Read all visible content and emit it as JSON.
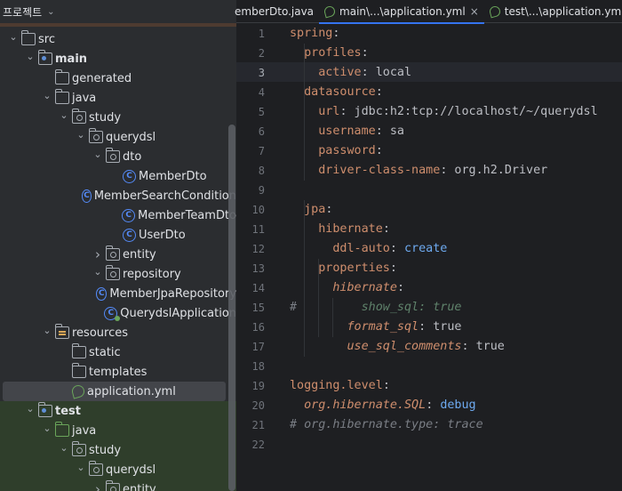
{
  "project": {
    "title": "프로젝트",
    "tree": [
      {
        "label": "src",
        "depth": 1,
        "arrow": "down",
        "icon": "folder"
      },
      {
        "label": "main",
        "depth": 2,
        "arrow": "down",
        "icon": "source-root-folder",
        "bold": true
      },
      {
        "label": "generated",
        "depth": 3,
        "arrow": "none",
        "icon": "folder"
      },
      {
        "label": "java",
        "depth": 3,
        "arrow": "down",
        "icon": "source-folder"
      },
      {
        "label": "study",
        "depth": 4,
        "arrow": "down",
        "icon": "package"
      },
      {
        "label": "querydsl",
        "depth": 5,
        "arrow": "down",
        "icon": "package"
      },
      {
        "label": "dto",
        "depth": 6,
        "arrow": "down",
        "icon": "package"
      },
      {
        "label": "MemberDto",
        "depth": 7,
        "arrow": "none",
        "icon": "class"
      },
      {
        "label": "MemberSearchCondition",
        "depth": 7,
        "arrow": "none",
        "icon": "class"
      },
      {
        "label": "MemberTeamDto",
        "depth": 7,
        "arrow": "none",
        "icon": "class"
      },
      {
        "label": "UserDto",
        "depth": 7,
        "arrow": "none",
        "icon": "class"
      },
      {
        "label": "entity",
        "depth": 6,
        "arrow": "right",
        "icon": "package"
      },
      {
        "label": "repository",
        "depth": 6,
        "arrow": "down",
        "icon": "package"
      },
      {
        "label": "MemberJpaRepository",
        "depth": 7,
        "arrow": "none",
        "icon": "class"
      },
      {
        "label": "QuerydslApplication",
        "depth": 6,
        "arrow": "none",
        "icon": "spring-class"
      },
      {
        "label": "resources",
        "depth": 3,
        "arrow": "down",
        "icon": "resources-folder"
      },
      {
        "label": "static",
        "depth": 4,
        "arrow": "none",
        "icon": "folder"
      },
      {
        "label": "templates",
        "depth": 4,
        "arrow": "none",
        "icon": "folder"
      },
      {
        "label": "application.yml",
        "depth": 4,
        "arrow": "none",
        "icon": "yaml-file",
        "selected": true
      },
      {
        "label": "test",
        "depth": 2,
        "arrow": "down",
        "icon": "test-root-folder",
        "bold": true
      },
      {
        "label": "java",
        "depth": 3,
        "arrow": "down",
        "icon": "test-source-folder"
      },
      {
        "label": "study",
        "depth": 4,
        "arrow": "down",
        "icon": "package"
      },
      {
        "label": "querydsl",
        "depth": 5,
        "arrow": "down",
        "icon": "package"
      },
      {
        "label": "entity",
        "depth": 6,
        "arrow": "right",
        "icon": "package"
      }
    ]
  },
  "tabs": [
    {
      "label": "MemberDto.java",
      "active": false,
      "icon": "java-class-icon"
    },
    {
      "label": "main\\...\\application.yml",
      "active": true,
      "icon": "yaml-icon",
      "close": "×"
    },
    {
      "label": "test\\...\\application.yml",
      "active": false,
      "icon": "yaml-icon"
    }
  ],
  "editor": {
    "current_line": 3,
    "lines": [
      {
        "n": "1",
        "segs": [
          {
            "t": "spring",
            "c": "k"
          },
          {
            "t": ":",
            "c": "v"
          }
        ]
      },
      {
        "n": "2",
        "segs": [
          {
            "t": "  ",
            "c": "v"
          },
          {
            "t": "profiles",
            "c": "k"
          },
          {
            "t": ":",
            "c": "v"
          }
        ]
      },
      {
        "n": "3",
        "segs": [
          {
            "t": "    ",
            "c": "v"
          },
          {
            "t": "active",
            "c": "k"
          },
          {
            "t": ": local",
            "c": "v"
          }
        ]
      },
      {
        "n": "4",
        "segs": [
          {
            "t": "  ",
            "c": "v"
          },
          {
            "t": "datasource",
            "c": "k"
          },
          {
            "t": ":",
            "c": "v"
          }
        ]
      },
      {
        "n": "5",
        "segs": [
          {
            "t": "    ",
            "c": "v"
          },
          {
            "t": "url",
            "c": "k"
          },
          {
            "t": ": jdbc:h2:tcp://localhost/~/querydsl",
            "c": "v"
          }
        ]
      },
      {
        "n": "6",
        "segs": [
          {
            "t": "    ",
            "c": "v"
          },
          {
            "t": "username",
            "c": "k"
          },
          {
            "t": ": sa",
            "c": "v"
          }
        ]
      },
      {
        "n": "7",
        "segs": [
          {
            "t": "    ",
            "c": "v"
          },
          {
            "t": "password",
            "c": "k"
          },
          {
            "t": ":",
            "c": "v"
          }
        ]
      },
      {
        "n": "8",
        "segs": [
          {
            "t": "    ",
            "c": "v"
          },
          {
            "t": "driver-class-name",
            "c": "k"
          },
          {
            "t": ": org.h2.Driver",
            "c": "v"
          }
        ]
      },
      {
        "n": "9",
        "segs": []
      },
      {
        "n": "10",
        "segs": [
          {
            "t": "  ",
            "c": "v"
          },
          {
            "t": "jpa",
            "c": "k"
          },
          {
            "t": ":",
            "c": "v"
          }
        ]
      },
      {
        "n": "11",
        "segs": [
          {
            "t": "    ",
            "c": "v"
          },
          {
            "t": "hibernate",
            "c": "k"
          },
          {
            "t": ":",
            "c": "v"
          }
        ]
      },
      {
        "n": "12",
        "segs": [
          {
            "t": "      ",
            "c": "v"
          },
          {
            "t": "ddl-auto",
            "c": "k"
          },
          {
            "t": ": ",
            "c": "v"
          },
          {
            "t": "create",
            "c": "kw"
          }
        ]
      },
      {
        "n": "13",
        "segs": [
          {
            "t": "    ",
            "c": "v"
          },
          {
            "t": "properties",
            "c": "k"
          },
          {
            "t": ":",
            "c": "v"
          }
        ]
      },
      {
        "n": "14",
        "segs": [
          {
            "t": "      ",
            "c": "v"
          },
          {
            "t": "hibernate",
            "c": "k it"
          },
          {
            "t": ":",
            "c": "v"
          }
        ]
      },
      {
        "n": "15",
        "segs": [
          {
            "t": "#",
            "c": "cm"
          },
          {
            "t": "         show_sql: true",
            "c": "cmg"
          }
        ]
      },
      {
        "n": "16",
        "segs": [
          {
            "t": "        ",
            "c": "v"
          },
          {
            "t": "format_sql",
            "c": "k it"
          },
          {
            "t": ": true",
            "c": "v"
          }
        ]
      },
      {
        "n": "17",
        "segs": [
          {
            "t": "        ",
            "c": "v"
          },
          {
            "t": "use_sql_comments",
            "c": "k it"
          },
          {
            "t": ": true",
            "c": "v"
          }
        ]
      },
      {
        "n": "18",
        "segs": []
      },
      {
        "n": "19",
        "segs": [
          {
            "t": "logging.level",
            "c": "k"
          },
          {
            "t": ":",
            "c": "v"
          }
        ]
      },
      {
        "n": "20",
        "segs": [
          {
            "t": "  ",
            "c": "v"
          },
          {
            "t": "org.hibernate.SQL",
            "c": "k it"
          },
          {
            "t": ": ",
            "c": "v"
          },
          {
            "t": "debug",
            "c": "kw"
          }
        ]
      },
      {
        "n": "21",
        "segs": [
          {
            "t": "# org.hibernate.type: trace",
            "c": "cm"
          }
        ]
      },
      {
        "n": "22",
        "segs": []
      }
    ]
  },
  "colors": {
    "key": "#cf8e6d",
    "keyword": "#6eaaf0",
    "comment": "#7a7e85",
    "accent": "#3574f0"
  }
}
